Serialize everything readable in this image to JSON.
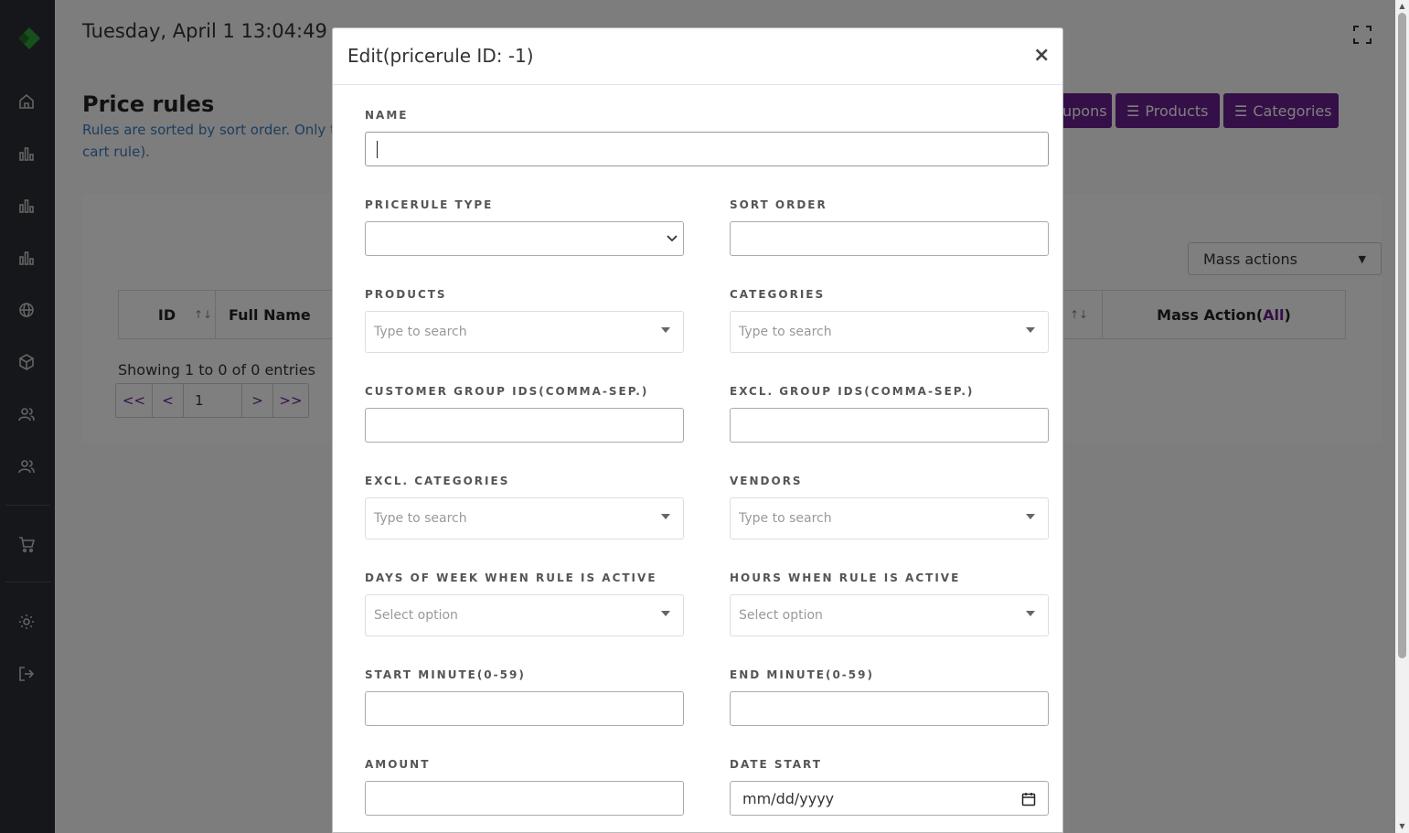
{
  "header": {
    "clock": "Tuesday, April 1 13:04:49"
  },
  "page": {
    "title": "Price rules",
    "description": "Rules are sorted by sort order. Only t",
    "description_line2": "cart rule)."
  },
  "top_buttons": [
    {
      "label": "upons"
    },
    {
      "label": "Products"
    },
    {
      "label": "Categories"
    }
  ],
  "table": {
    "mass_actions_label": "Mass actions",
    "columns": [
      {
        "label": "ID",
        "sortable": true
      },
      {
        "label": "Full Name"
      },
      {
        "label": "Mass Action(",
        "all_link": "All",
        "suffix": ")"
      }
    ],
    "showing": "Showing 1 to 0 of 0 entries",
    "pager": {
      "first": "<<",
      "prev": "<",
      "page": "1",
      "next": ">",
      "last": ">>"
    }
  },
  "modal": {
    "title": "Edit(pricerule ID: -1)",
    "close": "×",
    "fields": {
      "name": {
        "label": "NAME",
        "value": ""
      },
      "pricerule_type": {
        "label": "PRICERULE TYPE",
        "value": ""
      },
      "sort_order": {
        "label": "SORT ORDER",
        "value": ""
      },
      "products": {
        "label": "PRODUCTS",
        "placeholder": "Type to search"
      },
      "categories": {
        "label": "CATEGORIES",
        "placeholder": "Type to search"
      },
      "customer_group_ids": {
        "label": "CUSTOMER GROUP IDS(COMMA-SEP.)",
        "value": ""
      },
      "excl_group_ids": {
        "label": "EXCL. GROUP IDS(COMMA-SEP.)",
        "value": ""
      },
      "excl_categories": {
        "label": "EXCL. CATEGORIES",
        "placeholder": "Type to search"
      },
      "vendors": {
        "label": "VENDORS",
        "placeholder": "Type to search"
      },
      "days_of_week": {
        "label": "DAYS OF WEEK WHEN RULE IS ACTIVE",
        "placeholder": "Select option"
      },
      "hours": {
        "label": "HOURS WHEN RULE IS ACTIVE",
        "placeholder": "Select option"
      },
      "start_minute": {
        "label": "START MINUTE(0-59)",
        "value": ""
      },
      "end_minute": {
        "label": "END MINUTE(0-59)",
        "value": ""
      },
      "amount": {
        "label": "AMOUNT",
        "value": ""
      },
      "date_start": {
        "label": "DATE START",
        "placeholder": "mm/dd/yyyy"
      }
    }
  },
  "colors": {
    "brand_purple": "#6b1f8f",
    "sidebar_bg": "#2c2f36",
    "logo_green": "#2e9e3a",
    "overlay": "rgba(0,0,0,0.5)"
  }
}
